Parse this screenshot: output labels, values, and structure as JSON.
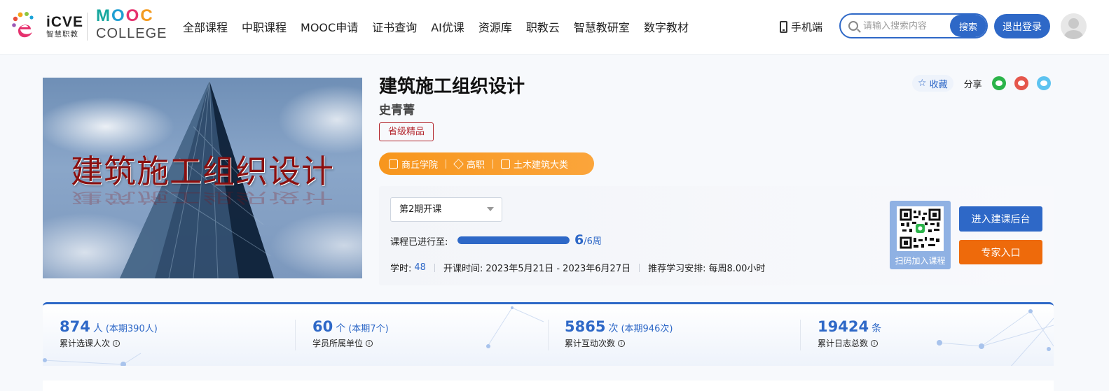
{
  "header": {
    "logo_icve_en": "iCVE",
    "logo_icve_cn": "智慧职教",
    "logo_mooc_letters": [
      "M",
      "O",
      "O",
      "C"
    ],
    "logo_mooc_college": "COLLEGE",
    "nav": [
      "全部课程",
      "中职课程",
      "MOOC申请",
      "证书查询",
      "AI优课",
      "资源库",
      "职教云",
      "智慧教研室",
      "数字教材"
    ],
    "mobile_label": "手机端",
    "search_placeholder": "请输入搜索内容",
    "search_button": "搜索",
    "logout_button": "退出登录"
  },
  "course": {
    "cover_title": "建筑施工组织设计",
    "title": "建筑施工组织设计",
    "teacher": "史青菁",
    "badge": "省级精品",
    "tags": [
      {
        "icon": "building-icon",
        "label": "商丘学院"
      },
      {
        "icon": "layers-icon",
        "label": "高职"
      },
      {
        "icon": "book-icon",
        "label": "土木建筑大类"
      }
    ],
    "favorite_label": "收藏",
    "share_label": "分享"
  },
  "term": {
    "selected": "第2期开课",
    "progress_label": "课程已进行至:",
    "progress_current": "6",
    "progress_total": "/6周",
    "progress_fraction": 1.0,
    "hours_label": "学时:",
    "hours_value": "48",
    "date_label": "开课时间:",
    "date_value": "2023年5月21日 - 2023年6月27日",
    "schedule_label": "推荐学习安排:",
    "schedule_value": "每周8.00小时",
    "qr_label": "扫码加入课程",
    "build_button": "进入建课后台",
    "expert_button": "专家入口"
  },
  "stats": [
    {
      "value": "874",
      "unit": "人",
      "sub": "(本期390人)",
      "label": "累计选课人次"
    },
    {
      "value": "60",
      "unit": "个",
      "sub": "(本期7个)",
      "label": "学员所属单位"
    },
    {
      "value": "5865",
      "unit": "次",
      "sub": "(本期946次)",
      "label": "累计互动次数"
    },
    {
      "value": "19424",
      "unit": "条",
      "sub": "",
      "label": "累计日志总数"
    }
  ],
  "colors": {
    "primary": "#2e68c7",
    "orange": "#ee6a0b",
    "tag_bar": "#f7961d",
    "badge": "#b3262d"
  }
}
